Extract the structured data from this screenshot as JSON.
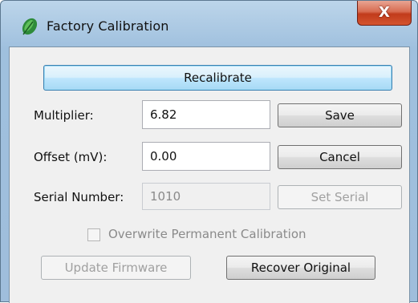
{
  "window": {
    "title": "Factory Calibration",
    "close_glyph": "X",
    "app_icon": "leaf-icon",
    "accent_color": "#3c7fb1"
  },
  "buttons": {
    "recalibrate": "Recalibrate",
    "save": "Save",
    "cancel": "Cancel",
    "set_serial": "Set Serial",
    "update_firmware": "Update Firmware",
    "recover_original": "Recover Original"
  },
  "fields": {
    "multiplier": {
      "label": "Multiplier:",
      "value": "6.82"
    },
    "offset": {
      "label": "Offset (mV):",
      "value": "0.00"
    },
    "serial": {
      "label": "Serial Number:",
      "value": "1010"
    }
  },
  "overwrite_checkbox": {
    "label": "Overwrite Permanent Calibration",
    "checked": false
  }
}
